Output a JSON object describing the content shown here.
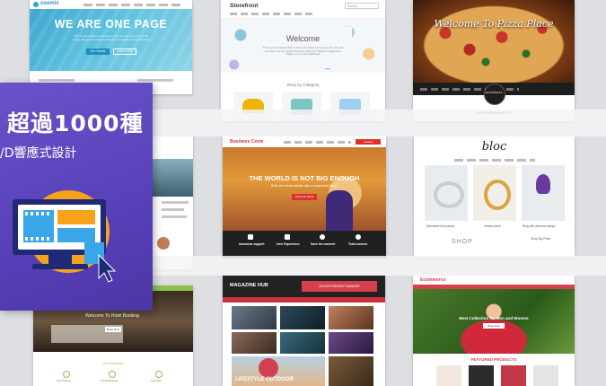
{
  "promo": {
    "title": "超過1000種",
    "subtitle": "/D響應式設計",
    "accent_color": "#f7a21b",
    "icon": "monitor-cursor-icon"
  },
  "themes": {
    "onepage": {
      "logo": "oxemix",
      "heading": "WE ARE ONE PAGE",
      "body": "We provide creative solutions to help you build your brand. We create design elements for all kinds of industries and businesses.",
      "btn1": "Our Works",
      "btn2": "Learn More",
      "footer": "Creative Service"
    },
    "storefront": {
      "logo": "Storefront",
      "search_placeholder": "Search",
      "welcome": "Welcome",
      "text": "This is your homepage which is what most visitors will see when they first visit your shop. You can change this text by editing the \"Welcome\" page via the \"Pages\" menu in your dashboard.",
      "category": "Shop by Category"
    },
    "pizza": {
      "script": "Welcome To Pizza Place",
      "badge": "ARCHITECTS",
      "caption": "ACHIEVERS IDENTITY"
    },
    "business": {
      "logo": "Business Cente",
      "cta": "Contact",
      "heading": "THE WORLD IS NOT BIG ENOUGH",
      "sub": "Build your dream website with our responsive theme",
      "button": "SIGN UP NOW",
      "features": [
        "Awesome support",
        "User Experience",
        "Save the moment",
        "Total connect"
      ]
    },
    "jewelry": {
      "logo": "bloc",
      "captions": [
        "Affordable fine jewelry",
        "Jewelry store",
        "Ring with diamond design"
      ],
      "shop": "SHOP",
      "filter": "Shop By Price"
    },
    "magazine": {
      "logo": "MAGAZINE HUB",
      "ad": "ADVERTISEMENT BANNER",
      "promo": "LIFESTYLE OUTDOOR"
    },
    "fashion": {
      "logo": "Ecommerce",
      "hero": "Best Collection for Men and Women",
      "button": "Shop Now",
      "section": "FEATURED PRODUCTS"
    },
    "hotel": {
      "hero": "Welcome To Hotel Booking",
      "button": "Book Now",
      "services": "Our Services",
      "items": [
        "Free Parking",
        "Family Booking",
        "Free Wifi"
      ]
    }
  }
}
